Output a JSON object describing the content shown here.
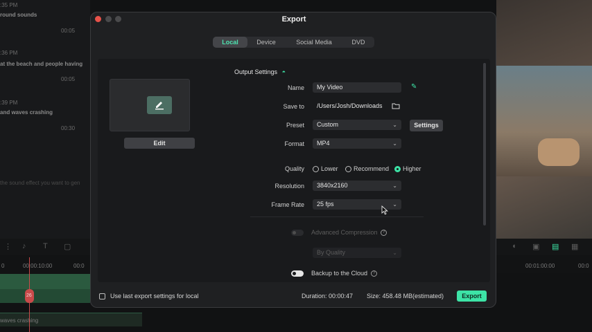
{
  "background": {
    "left_panel": [
      {
        "time": ":35 PM",
        "text": "round sounds",
        "duration": "00:05"
      },
      {
        "time": ":36 PM",
        "text": "at the beach and people having",
        "duration": "00:05"
      },
      {
        "time": ":39 PM",
        "text": " and waves crashing",
        "duration": "00:30"
      }
    ],
    "prompt_hint": "the sound effect you want to gen",
    "ruler": [
      "0",
      "00:00:10:00",
      "00:0",
      "00:01:00:00",
      "00:0"
    ],
    "audio_label": "waves crashing",
    "clip_badge": "26"
  },
  "dialog": {
    "title": "Export",
    "tabs": [
      {
        "label": "Local",
        "active": true
      },
      {
        "label": "Device",
        "active": false
      },
      {
        "label": "Social Media",
        "active": false
      },
      {
        "label": "DVD",
        "active": false
      }
    ],
    "edit_label": "Edit",
    "output_settings_label": "Output Settings",
    "name": {
      "label": "Name",
      "value": "My Video"
    },
    "save_to": {
      "label": "Save to",
      "value": "/Users/Josh/Downloads"
    },
    "preset": {
      "label": "Preset",
      "value": "Custom",
      "settings_label": "Settings"
    },
    "format": {
      "label": "Format",
      "value": "MP4"
    },
    "quality": {
      "label": "Quality",
      "options": [
        {
          "label": "Lower",
          "selected": false
        },
        {
          "label": "Recommend",
          "selected": false
        },
        {
          "label": "Higher",
          "selected": true
        }
      ]
    },
    "resolution": {
      "label": "Resolution",
      "value": "3840x2160"
    },
    "frame_rate": {
      "label": "Frame Rate",
      "value": "25 fps"
    },
    "advanced_compression": {
      "label": "Advanced Compression",
      "enabled": false,
      "mode": "By Quality"
    },
    "backup_cloud": {
      "label": "Backup to the Cloud",
      "enabled": false
    },
    "footer": {
      "use_last_label": "Use last export settings for local",
      "duration": "Duration: 00:00:47",
      "size": "Size: 458.48 MB(estimated)",
      "export_label": "Export"
    },
    "colors": {
      "accent": "#3de3a6",
      "close": "#e8524a",
      "minimize": "#4a4a4c",
      "zoom": "#4a4a4c"
    }
  }
}
